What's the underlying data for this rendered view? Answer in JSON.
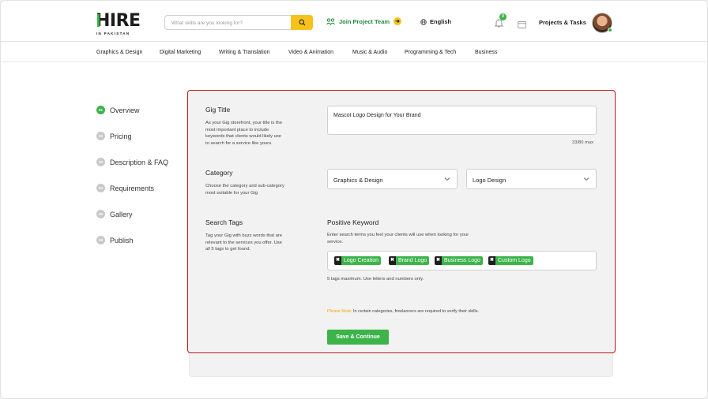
{
  "brand": {
    "logo_word": "HIRE",
    "logo_sub": "IN PAKISTAN"
  },
  "header": {
    "search_placeholder": "What skills are you looking for?",
    "join_label": "Join Project Team",
    "language": "English",
    "notification_count": "0",
    "projects_label": "Projects & Tasks"
  },
  "categories": [
    "Graphics & Design",
    "Digital Marketing",
    "Writing & Translation",
    "Video & Animation",
    "Music & Audio",
    "Programming & Tech",
    "Business"
  ],
  "steps": [
    {
      "num": "01",
      "label": "Overview",
      "active": true
    },
    {
      "num": "02",
      "label": "Pricing",
      "active": false
    },
    {
      "num": "03",
      "label": "Description & FAQ",
      "active": false
    },
    {
      "num": "04",
      "label": "Requirements",
      "active": false
    },
    {
      "num": "05",
      "label": "Gallery",
      "active": false
    },
    {
      "num": "06",
      "label": "Publish",
      "active": false
    }
  ],
  "gig_title": {
    "heading": "Gig Title",
    "description": "As your Gig storefront, your title is the most important place to include keywords that clients would likely use to search for a service like yours.",
    "value": "Mascot Logo Design for Your Brand",
    "counter": "33/80 max"
  },
  "category": {
    "heading": "Category",
    "description": "Choose the category and sub-category most suitable for your Gig",
    "main_value": "Graphics & Design",
    "sub_value": "Logo Design"
  },
  "search_tags": {
    "heading": "Search Tags",
    "description": "Tag your Gig with buzz words that are relevant to the services you offer. Use all 5 tags to get found.",
    "keyword_heading": "Positive Keyword",
    "keyword_description": "Enter search terms you feel your clients will use when looking for your service.",
    "tags": [
      "Logo Creation",
      "Brand Logo",
      "Business Logo",
      "Custom Logo"
    ],
    "remove_symbol": "✖",
    "note": "5 tags maximum. Use letters and numbers only."
  },
  "notice": {
    "label": "Please Note:",
    "text": " In certain categories, freelancers are required to verify their skills."
  },
  "save_label": "Save & Continue",
  "colors": {
    "accent_green": "#3cb44a",
    "accent_yellow": "#f7c21b",
    "panel_border": "#b8161c"
  }
}
